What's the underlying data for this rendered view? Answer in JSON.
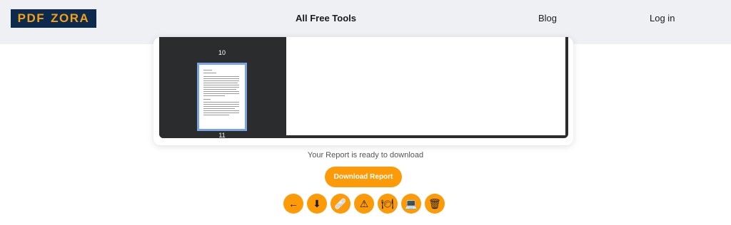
{
  "header": {
    "logo_text": "PDF",
    "logo_text2": "ZORA",
    "nav": {
      "tools": "All Free Tools",
      "blog": "Blog",
      "login": "Log in"
    }
  },
  "viewer": {
    "pages": [
      "10",
      "11"
    ]
  },
  "status": {
    "message": "Your Report is ready to download"
  },
  "actions": {
    "download_label": "Download Report"
  },
  "toolbar": {
    "icons": [
      {
        "name": "back-arrow-icon",
        "glyph": "←"
      },
      {
        "name": "download-icon",
        "glyph": "⬇"
      },
      {
        "name": "bandage-icon",
        "glyph": "🩹"
      },
      {
        "name": "warning-icon",
        "glyph": "⚠"
      },
      {
        "name": "cloche-icon",
        "glyph": "🍽"
      },
      {
        "name": "laptop-icon",
        "glyph": "💻"
      },
      {
        "name": "trash-icon",
        "glyph": "🗑"
      }
    ]
  },
  "colors": {
    "accent": "#fd9a08",
    "viewer_bg": "#2b2c2e",
    "header_bg": "#eef0f4",
    "logo_bg": "#0c2a4d"
  }
}
